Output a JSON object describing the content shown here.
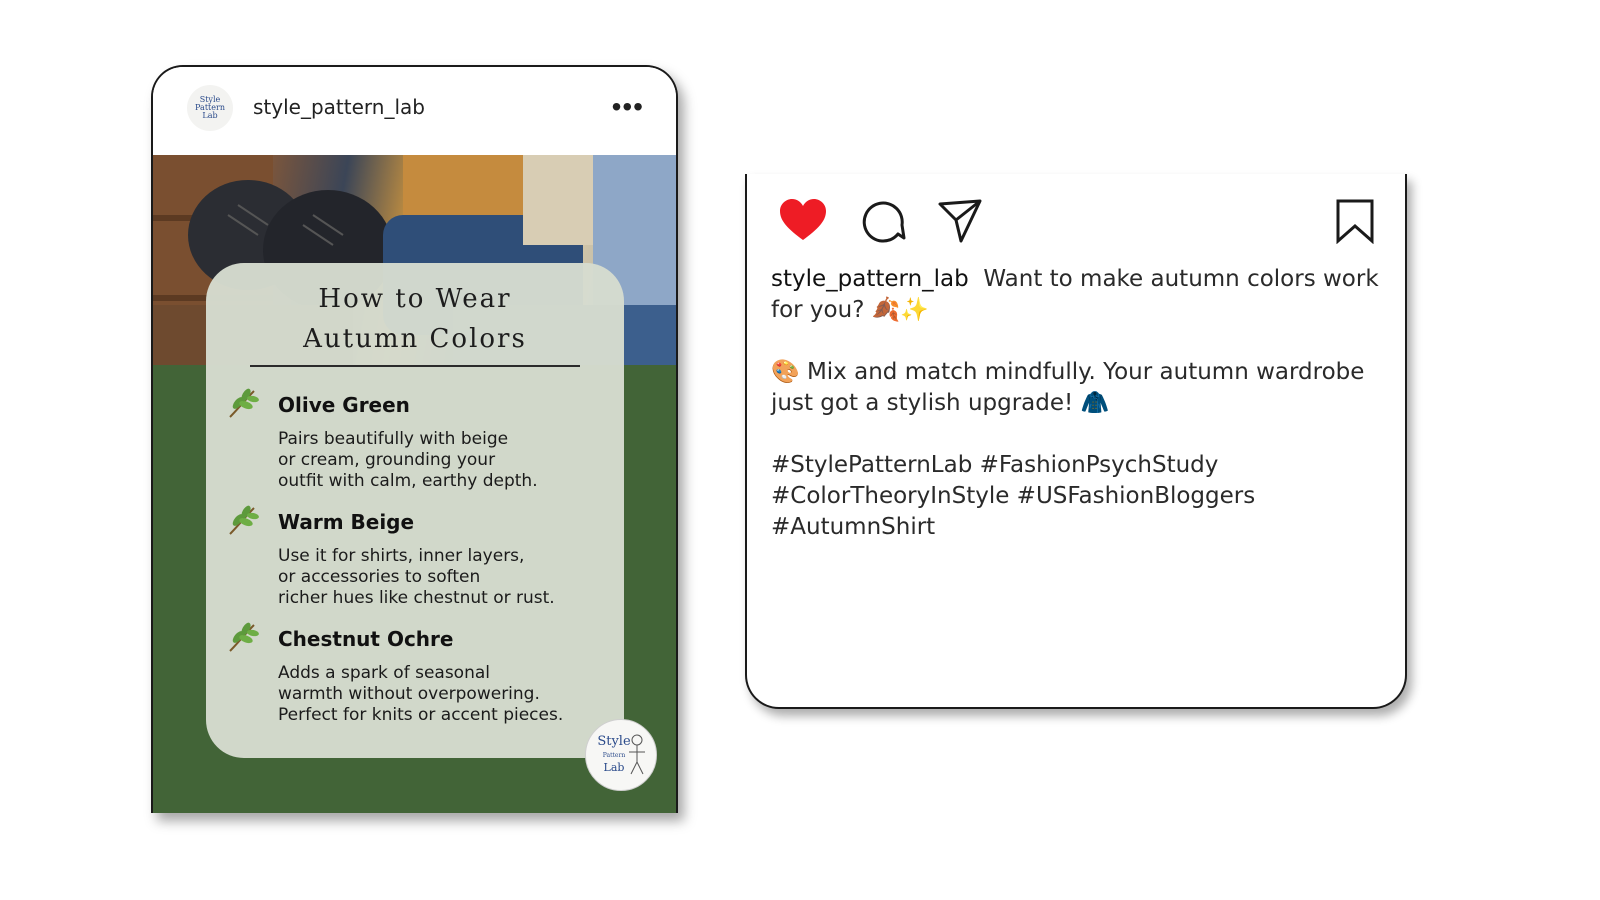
{
  "post": {
    "username": "style_pattern_lab",
    "avatar_text": "Style Pattern Lab",
    "more_icon": "more-horizontal-icon",
    "info": {
      "title": "How to Wear\nAutumn Colors",
      "items": [
        {
          "heading": "Olive Green",
          "description": "Pairs beautifully with beige\nor cream, grounding your\noutfit with calm, earthy depth.",
          "icon": "leaf-icon"
        },
        {
          "heading": "Warm Beige",
          "description": "Use it for shirts, inner layers,\nor accessories to soften\nricher hues like chestnut or rust.",
          "icon": "leaf-icon"
        },
        {
          "heading": "Chestnut Ochre",
          "description": "Adds a spark of seasonal\nwarmth without overpowering.\nPerfect for knits or accent pieces.",
          "icon": "leaf-icon"
        }
      ]
    },
    "logo": {
      "line1": "Style",
      "line2": "Pattern",
      "line3": "Lab"
    }
  },
  "caption_card": {
    "actions": {
      "like_icon": "heart-filled-icon",
      "comment_icon": "comment-icon",
      "share_icon": "send-icon",
      "save_icon": "bookmark-icon"
    },
    "username": "style_pattern_lab",
    "intro": "Want to make autumn colors work for you? 🍂✨",
    "body": "🎨 Mix and match mindfully. Your autumn wardrobe just got a stylish upgrade! 🧥",
    "hashtags": "#StylePatternLab #FashionPsychStudy\n#ColorTheoryInStyle #USFashionBloggers\n#AutumnShirt"
  },
  "colors": {
    "like": "#ee1c25",
    "green_background": "#426437",
    "panel": "#d6dcd0"
  }
}
